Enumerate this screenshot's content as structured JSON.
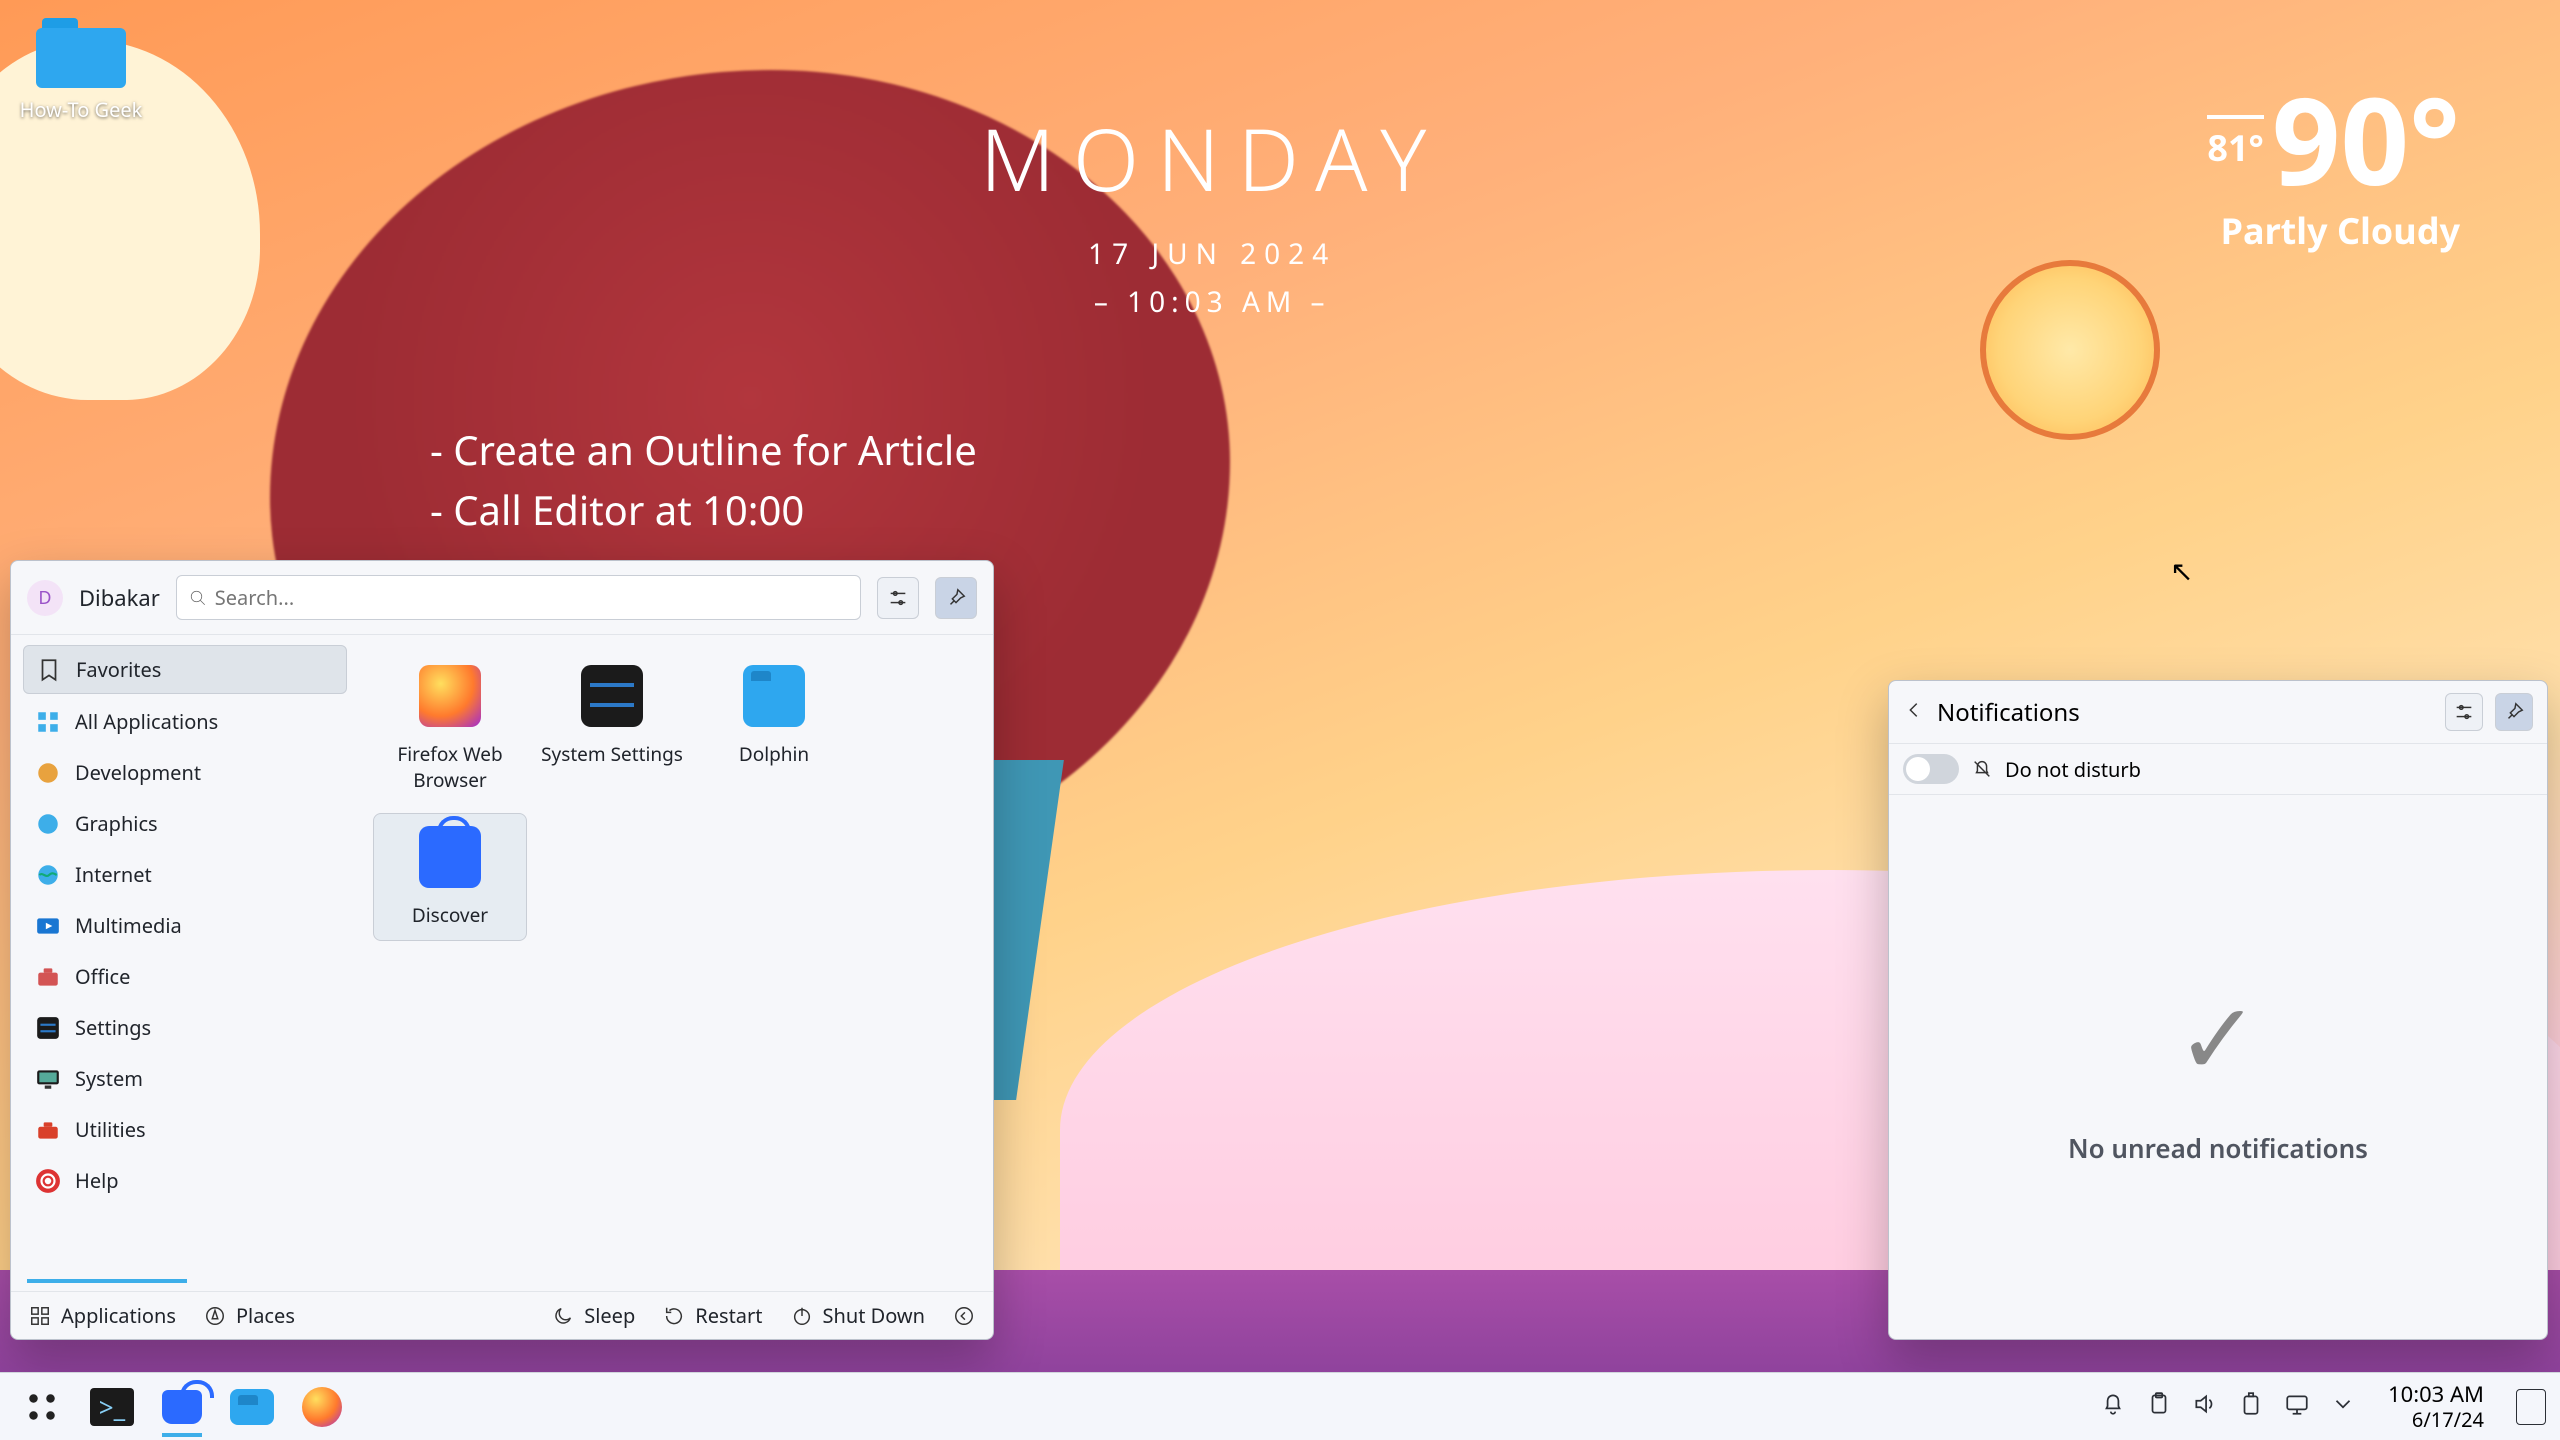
{
  "desktop": {
    "folder_name": "How-To Geek"
  },
  "day_widget": {
    "day": "MONDAY",
    "date": "17 JUN 2024",
    "time": "– 10:03 AM –"
  },
  "todo": {
    "items": [
      "- Create an Outline for Article",
      "- Call Editor at 10:00"
    ]
  },
  "weather": {
    "low": "81°",
    "main": "90°",
    "condition": "Partly Cloudy"
  },
  "launcher": {
    "username": "Dibakar",
    "avatar_letter": "D",
    "search_placeholder": "Search...",
    "categories": [
      {
        "label": "Favorites",
        "active": true
      },
      {
        "label": "All Applications"
      },
      {
        "label": "Development"
      },
      {
        "label": "Graphics"
      },
      {
        "label": "Internet"
      },
      {
        "label": "Multimedia"
      },
      {
        "label": "Office"
      },
      {
        "label": "Settings"
      },
      {
        "label": "System"
      },
      {
        "label": "Utilities"
      },
      {
        "label": "Help"
      }
    ],
    "apps": [
      {
        "label": "Firefox Web Browser"
      },
      {
        "label": "System Settings"
      },
      {
        "label": "Dolphin"
      },
      {
        "label": "Discover",
        "hovered": true
      }
    ],
    "tabs": {
      "applications": "Applications",
      "places": "Places"
    },
    "power": {
      "sleep": "Sleep",
      "restart": "Restart",
      "shutdown": "Shut Down"
    }
  },
  "notifications": {
    "title": "Notifications",
    "dnd_label": "Do not disturb",
    "empty_message": "No unread notifications"
  },
  "taskbar": {
    "clock_time": "10:03 AM",
    "clock_date": "6/17/24"
  }
}
